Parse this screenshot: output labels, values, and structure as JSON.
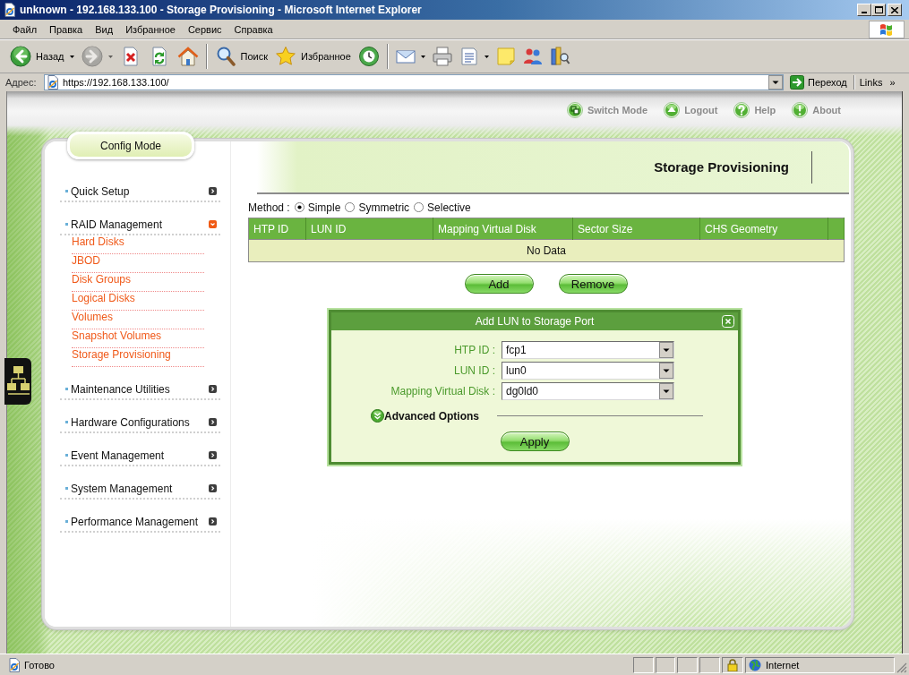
{
  "window": {
    "title": "unknown - 192.168.133.100 - Storage Provisioning - Microsoft Internet Explorer"
  },
  "menu": [
    "Файл",
    "Правка",
    "Вид",
    "Избранное",
    "Сервис",
    "Справка"
  ],
  "toolbar": {
    "groups": [
      [
        {
          "kind": "back",
          "label": "Назад",
          "dropdown": true,
          "disabled": false
        },
        {
          "kind": "forward",
          "dropdown": true,
          "disabled": true
        },
        {
          "kind": "stop",
          "dropdown": false,
          "disabled": false
        },
        {
          "kind": "refresh",
          "dropdown": false,
          "disabled": false
        },
        {
          "kind": "home",
          "dropdown": false,
          "disabled": false
        }
      ],
      [
        {
          "kind": "search",
          "label": "Поиск",
          "dropdown": false,
          "disabled": false
        },
        {
          "kind": "favorites",
          "label": "Избранное",
          "dropdown": false,
          "disabled": false
        },
        {
          "kind": "history",
          "dropdown": false,
          "disabled": false
        }
      ],
      [
        {
          "kind": "mail",
          "dropdown": true,
          "disabled": false
        },
        {
          "kind": "print",
          "dropdown": false,
          "disabled": false
        },
        {
          "kind": "edit",
          "dropdown": true,
          "disabled": false
        },
        {
          "kind": "note",
          "dropdown": false,
          "disabled": false
        },
        {
          "kind": "messenger",
          "dropdown": false,
          "disabled": false
        },
        {
          "kind": "research",
          "dropdown": false,
          "disabled": false
        }
      ]
    ]
  },
  "address": {
    "label": "Адрес:",
    "url": "https://192.168.133.100/",
    "go": "Переход",
    "links": "Links",
    "more": "»"
  },
  "header_links": [
    {
      "kind": "switch",
      "label": "Switch Mode"
    },
    {
      "kind": "logout",
      "label": "Logout"
    },
    {
      "kind": "help",
      "label": "Help"
    },
    {
      "kind": "about",
      "label": "About"
    }
  ],
  "mode_tab": "Config Mode",
  "sidebar": {
    "items": [
      {
        "label": "Quick Setup",
        "expanded": false
      },
      {
        "label": "RAID Management",
        "expanded": true,
        "children": [
          {
            "label": "Hard Disks"
          },
          {
            "label": "JBOD"
          },
          {
            "label": "Disk Groups"
          },
          {
            "label": "Logical Disks"
          },
          {
            "label": "Volumes"
          },
          {
            "label": "Snapshot Volumes"
          },
          {
            "label": "Storage Provisioning"
          }
        ]
      },
      {
        "label": "Maintenance Utilities",
        "expanded": false
      },
      {
        "label": "Hardware Configurations",
        "expanded": false
      },
      {
        "label": "Event Management",
        "expanded": false
      },
      {
        "label": "System Management",
        "expanded": false
      },
      {
        "label": "Performance Management",
        "expanded": false
      }
    ]
  },
  "content": {
    "title": "Storage Provisioning",
    "method": {
      "label": "Method :",
      "options": [
        {
          "label": "Simple",
          "selected": true
        },
        {
          "label": "Symmetric",
          "selected": false
        },
        {
          "label": "Selective",
          "selected": false
        }
      ]
    },
    "table": {
      "columns": [
        "HTP ID",
        "LUN ID",
        "Mapping Virtual Disk",
        "Sector Size",
        "CHS Geometry"
      ],
      "empty_text": "No Data"
    },
    "actions": [
      "Add",
      "Remove"
    ]
  },
  "dialog": {
    "title": "Add LUN to Storage Port",
    "fields": [
      {
        "label": "HTP ID :",
        "value": "fcp1"
      },
      {
        "label": "LUN ID :",
        "value": "lun0"
      },
      {
        "label": "Mapping Virtual Disk :",
        "value": "dg0ld0"
      }
    ],
    "advanced": {
      "label": "Advanced Options",
      "expanded": false
    },
    "button": "Apply"
  },
  "status_bar": {
    "text": "Готово",
    "zone": "Internet"
  }
}
